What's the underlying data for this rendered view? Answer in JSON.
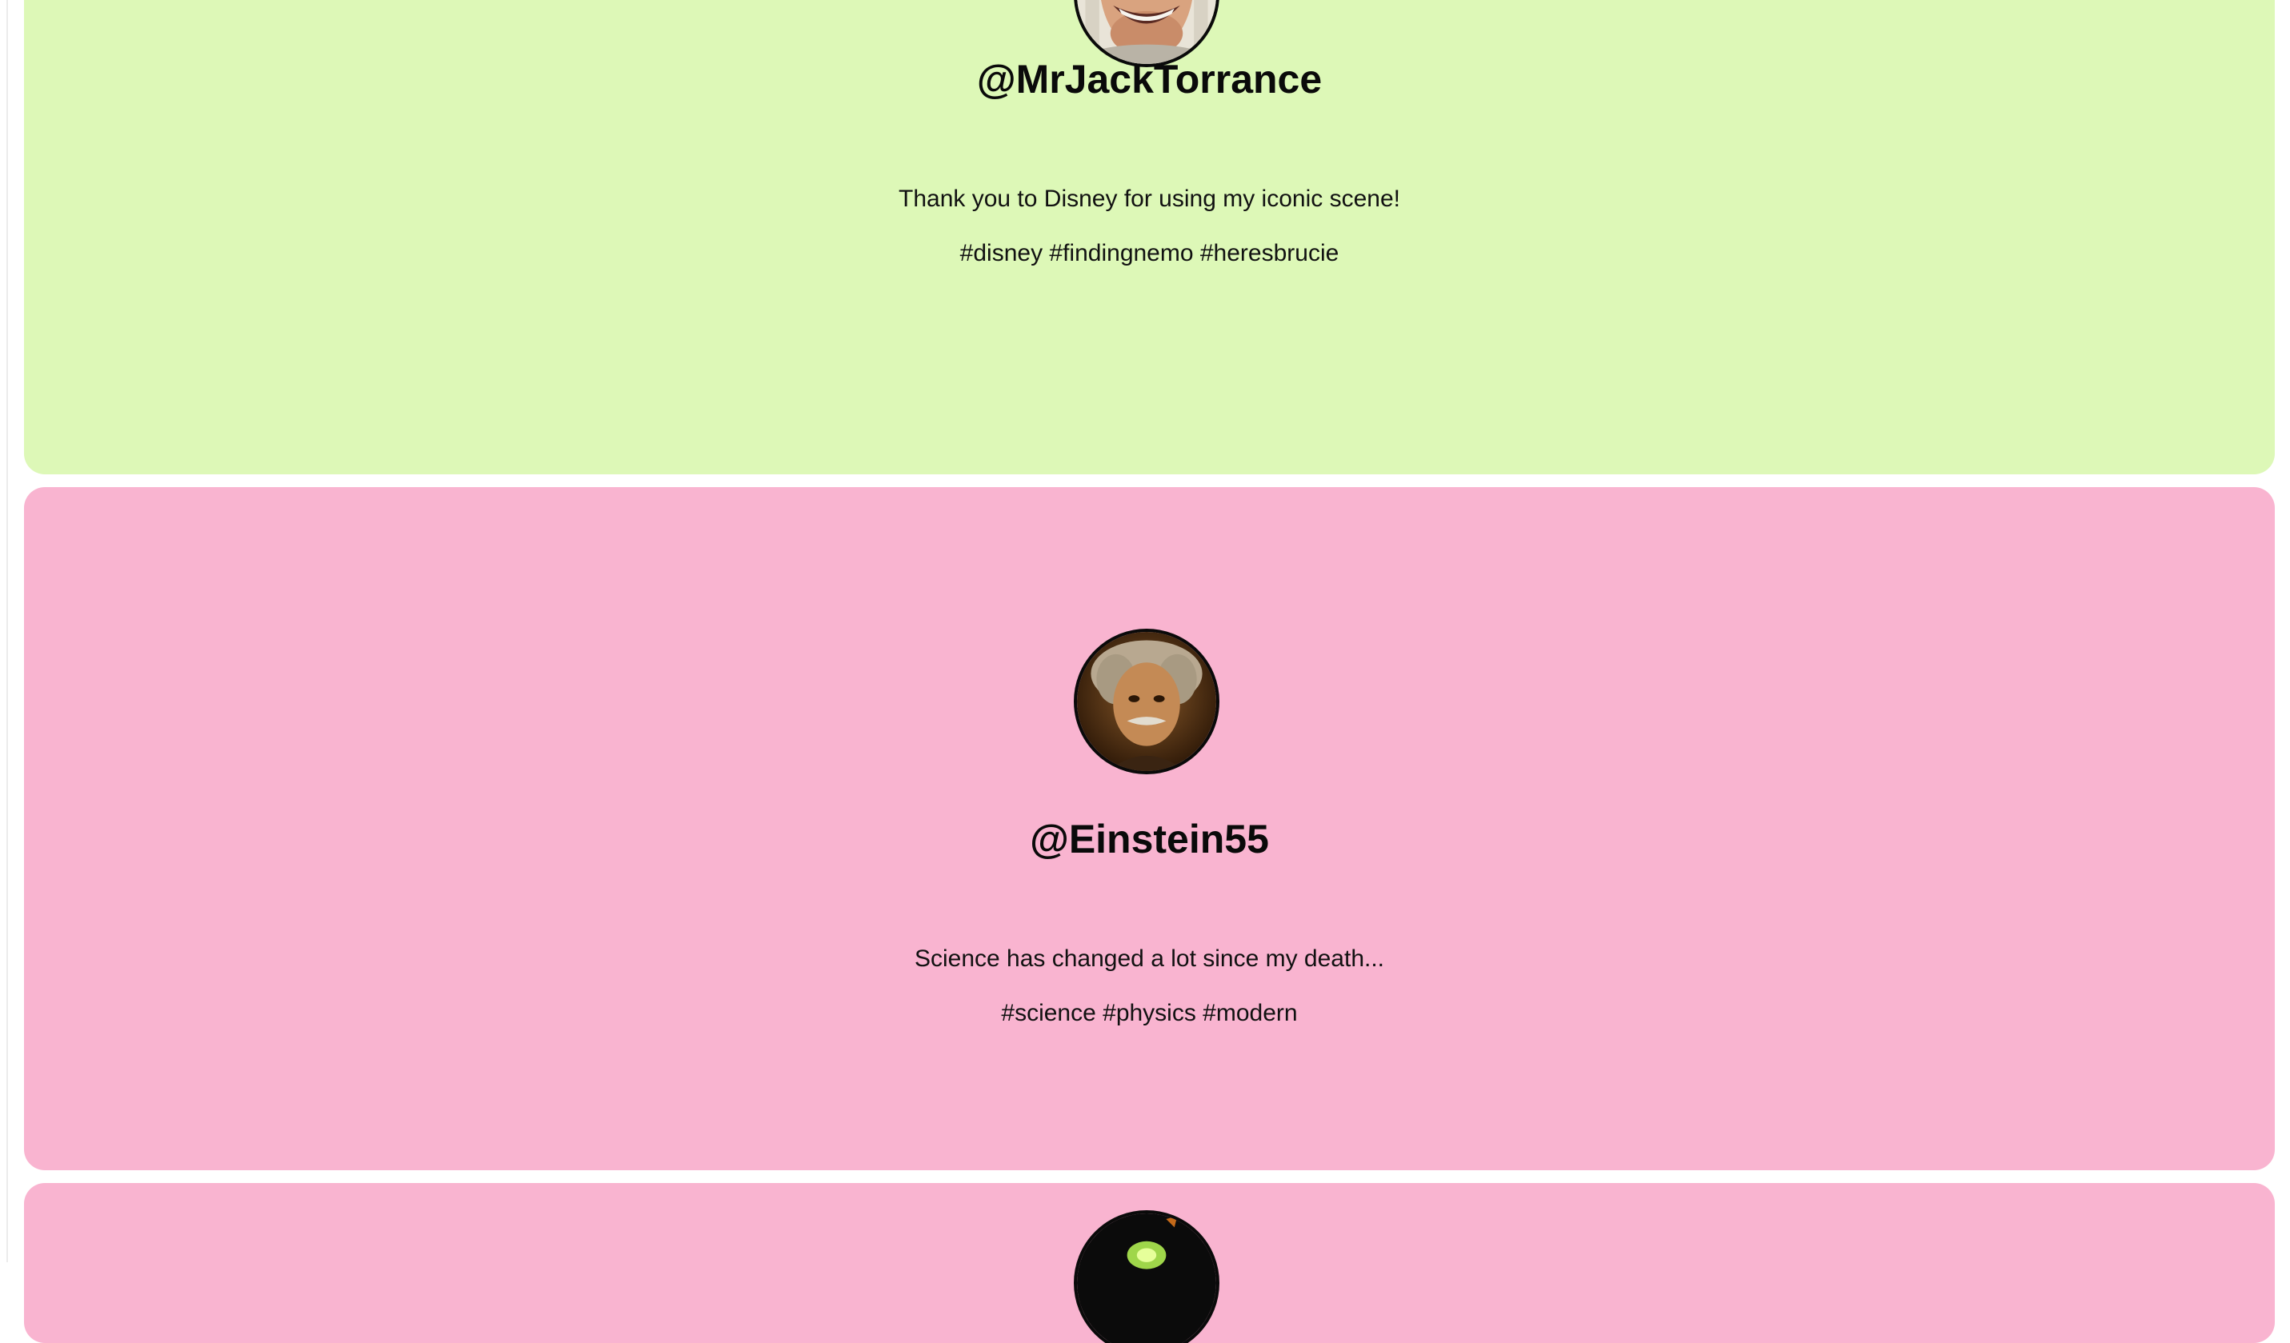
{
  "colors": {
    "card_green": "#ddf8b7",
    "card_pink": "#f9b4d0",
    "text": "#0a0a0a"
  },
  "posts": [
    {
      "username": "@MrJackTorrance",
      "text": "Thank you to Disney for using my iconic scene!",
      "hashtags": "#disney #findingnemo #heresbrucie",
      "avatar_icon": "grinning-man-avatar",
      "color": "#ddf8b7"
    },
    {
      "username": "@Einstein55",
      "text": "Science has changed a lot since my death...",
      "hashtags": "#science #physics #modern",
      "avatar_icon": "einstein-portrait-avatar",
      "color": "#f9b4d0"
    },
    {
      "avatar_icon": "dark-green-glow-avatar",
      "color": "#f9b4d0"
    }
  ]
}
